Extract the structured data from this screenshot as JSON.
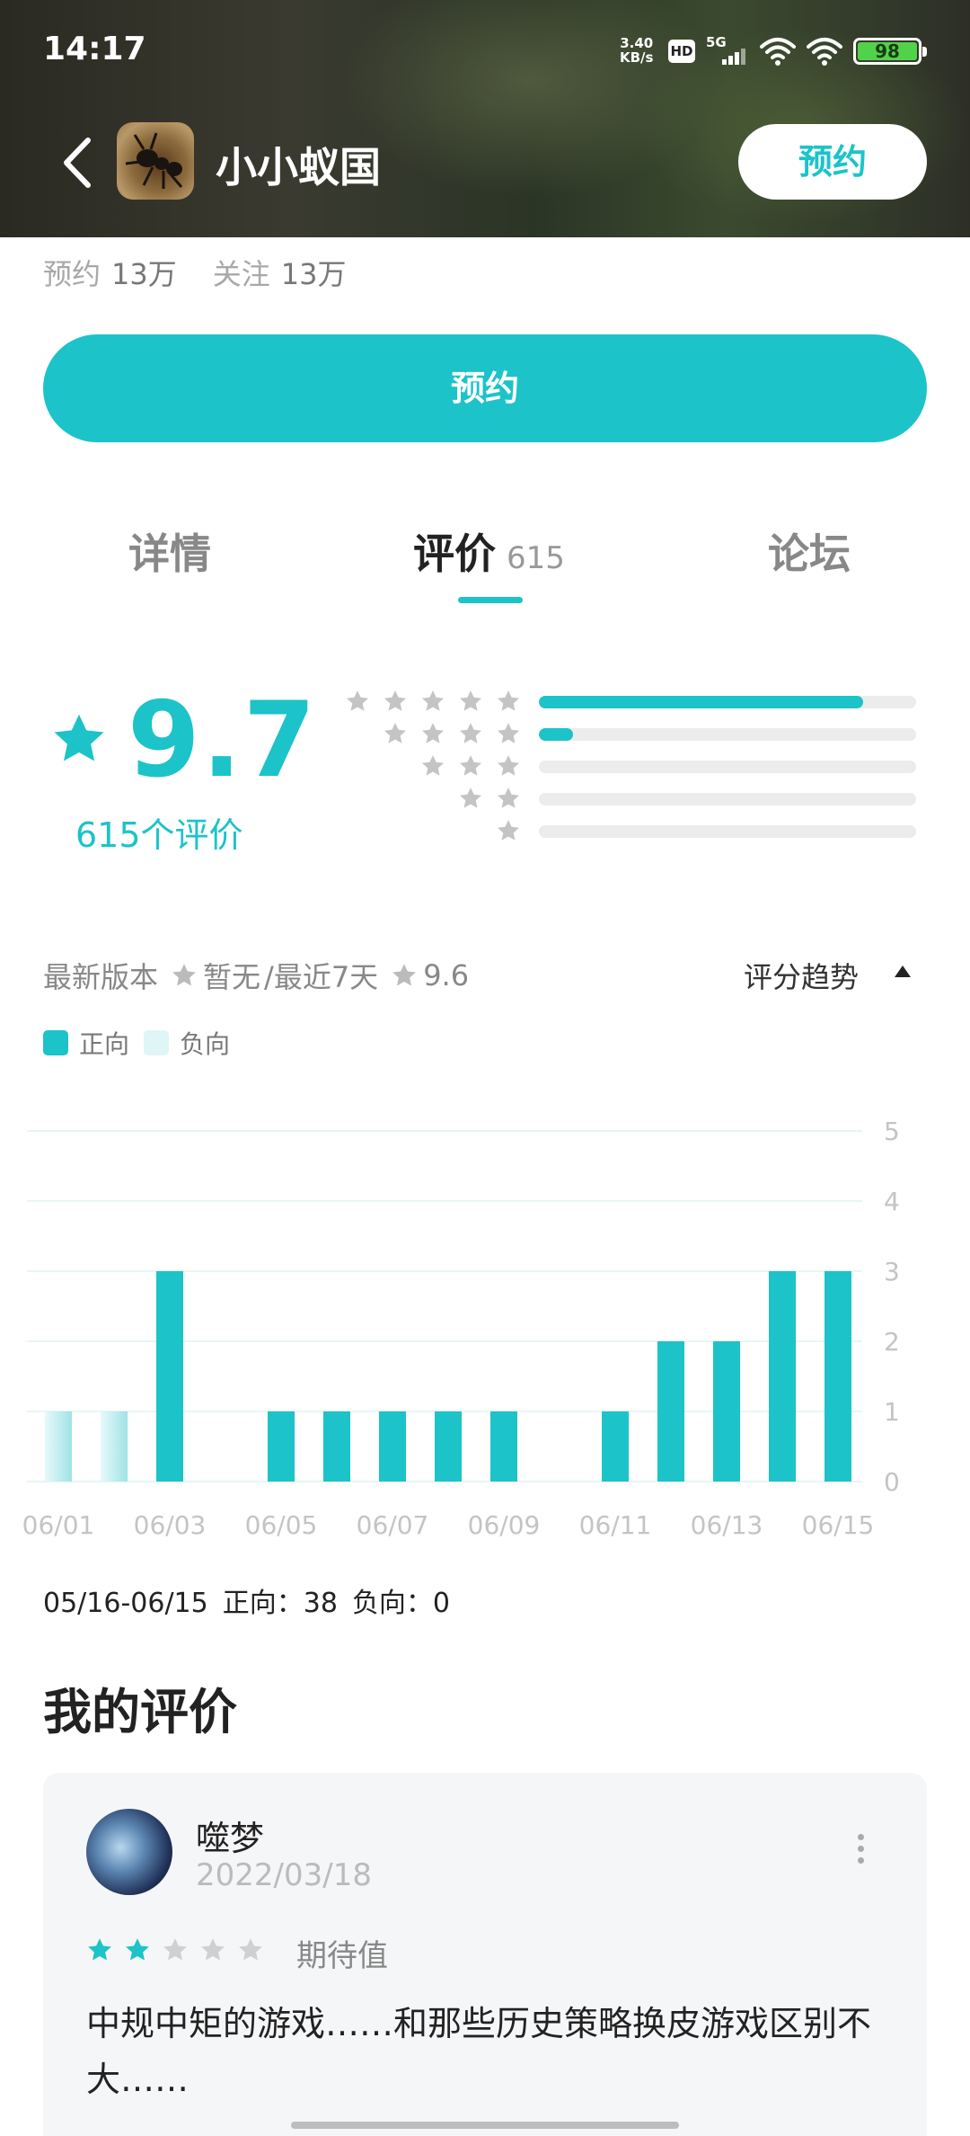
{
  "status_bar": {
    "time": "14:17",
    "net_speed_value": "3.40",
    "net_speed_unit": "KB/s",
    "hd_badge": "HD",
    "network": "5G",
    "battery": "98"
  },
  "header": {
    "title": "小小蚁国",
    "reserve_button": "预约"
  },
  "stats": {
    "reserve_label": "预约",
    "reserve_value": "13万",
    "follow_label": "关注",
    "follow_value": "13万"
  },
  "main_reserve_button": "预约",
  "tabs": [
    {
      "label": "详情"
    },
    {
      "label": "评价",
      "count": "615",
      "active": true
    },
    {
      "label": "论坛"
    }
  ],
  "rating": {
    "score": "9.7",
    "count_label": "615个评价",
    "distribution": [
      {
        "stars": 5,
        "fraction": 0.86
      },
      {
        "stars": 4,
        "fraction": 0.09
      },
      {
        "stars": 3,
        "fraction": 0.0
      },
      {
        "stars": 2,
        "fraction": 0.0
      },
      {
        "stars": 1,
        "fraction": 0.0
      }
    ]
  },
  "trend": {
    "latest_version_label": "最新版本",
    "latest_version_value": "暂无",
    "recent_label": "/最近7天",
    "recent_value": "9.6",
    "toggle_label": "评分趋势"
  },
  "legend": {
    "positive": "正向",
    "negative": "负向"
  },
  "colors": {
    "accent": "#1cc3c9",
    "negative": "#dff6f7",
    "track": "#ececec"
  },
  "chart_data": {
    "type": "bar",
    "categories": [
      "06/01",
      "06/02",
      "06/03",
      "06/04",
      "06/05",
      "06/06",
      "06/07",
      "06/08",
      "06/09",
      "06/10",
      "06/11",
      "06/12",
      "06/13",
      "06/14",
      "06/15"
    ],
    "x_tick_labels": [
      "06/01",
      "06/03",
      "06/05",
      "06/07",
      "06/09",
      "06/11",
      "06/13",
      "06/15"
    ],
    "y_ticks": [
      "0",
      "1",
      "2",
      "3",
      "4",
      "5"
    ],
    "ylim": [
      0,
      5
    ],
    "series": [
      {
        "name": "正向",
        "values": [
          1,
          1,
          3,
          0,
          1,
          1,
          1,
          1,
          1,
          0,
          1,
          2,
          2,
          3,
          3
        ]
      },
      {
        "name": "负向",
        "values": [
          0,
          0,
          0,
          0,
          0,
          0,
          0,
          0,
          0,
          0,
          0,
          0,
          0,
          0,
          0
        ]
      }
    ],
    "title": "",
    "xlabel": "",
    "ylabel": "",
    "grid": true,
    "legend_position": "top-left"
  },
  "summary": {
    "range": "05/16-06/15",
    "positive": "正向：38",
    "negative": "负向：0"
  },
  "my_review": {
    "title": "我的评价",
    "name": "噬梦",
    "date": "2022/03/18",
    "stars": 2,
    "tag": "期待值",
    "text": "中规中矩的游戏……和那些历史策略换皮游戏区别不大……"
  }
}
